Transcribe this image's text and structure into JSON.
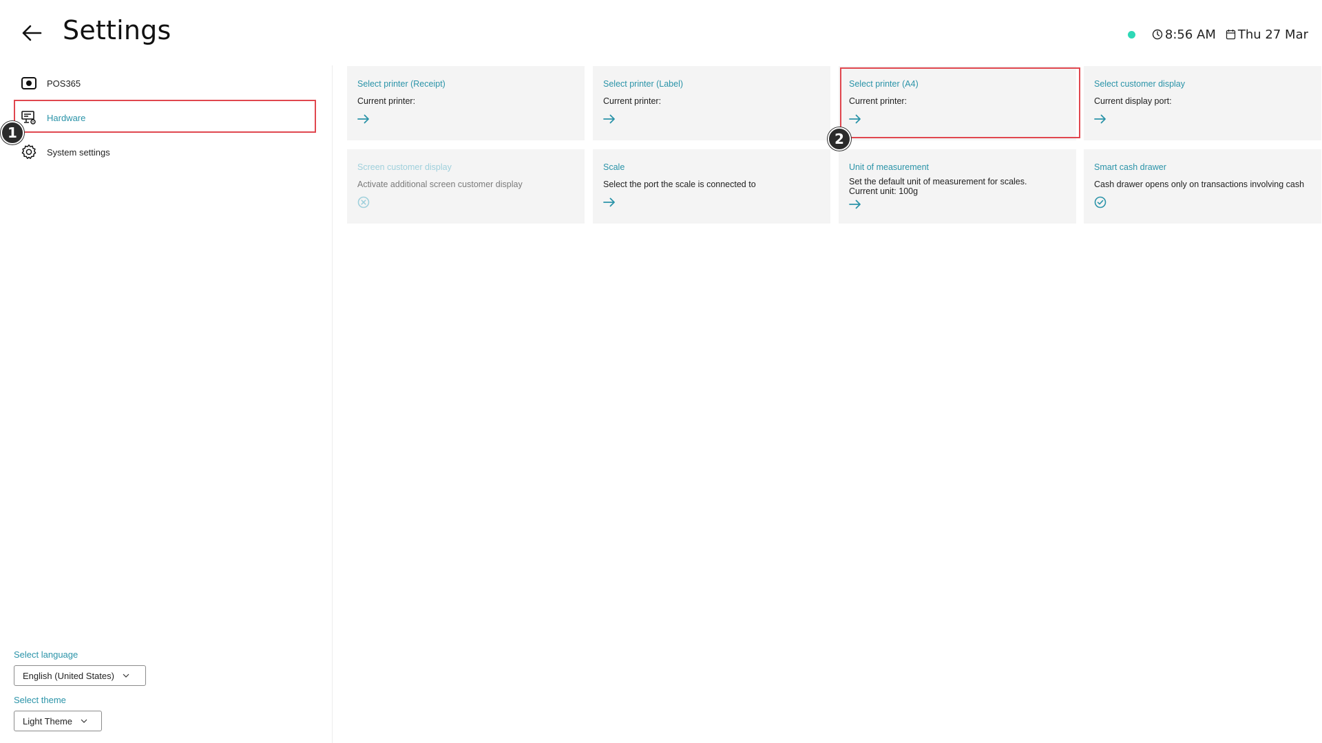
{
  "header": {
    "title": "Settings",
    "time": "8:56 AM",
    "date": "Thu 27 Mar",
    "status_color": "#2ed8b6"
  },
  "sidebar": {
    "items": [
      {
        "label": "POS365",
        "icon": "pos-camera-icon"
      },
      {
        "label": "Hardware",
        "icon": "hardware-monitor-icon",
        "active": true
      },
      {
        "label": "System settings",
        "icon": "gear-icon"
      }
    ],
    "language": {
      "label": "Select language",
      "value": "English (United States)"
    },
    "theme": {
      "label": "Select theme",
      "value": "Light Theme"
    }
  },
  "cards": [
    {
      "title": "Select printer (Receipt)",
      "desc": "Current printer:",
      "icon": "arrow-right-icon"
    },
    {
      "title": "Select printer (Label)",
      "desc": "Current printer:",
      "icon": "arrow-right-icon"
    },
    {
      "title": "Select printer (A4)",
      "desc": "Current printer:",
      "icon": "arrow-right-icon"
    },
    {
      "title": "Select customer display",
      "desc": "Current display port:",
      "icon": "arrow-right-icon"
    },
    {
      "title": "Screen customer display",
      "desc": "Activate additional screen customer display",
      "icon": "x-circle-icon",
      "disabled": true
    },
    {
      "title": "Scale",
      "desc": "Select the port the scale is connected to",
      "icon": "arrow-right-icon"
    },
    {
      "title": "Unit of measurement",
      "desc": "Set the default unit of measurement for scales.\nCurrent unit: 100g",
      "icon": "arrow-right-icon"
    },
    {
      "title": "Smart cash drawer",
      "desc": "Cash drawer opens only on transactions involving cash",
      "icon": "check-circle-icon"
    }
  ],
  "annotations": {
    "step1": "1",
    "step2": "2",
    "highlight_color": "#e0464e"
  },
  "colors": {
    "accent": "#2a93a8",
    "card_bg": "#f4f4f4"
  }
}
